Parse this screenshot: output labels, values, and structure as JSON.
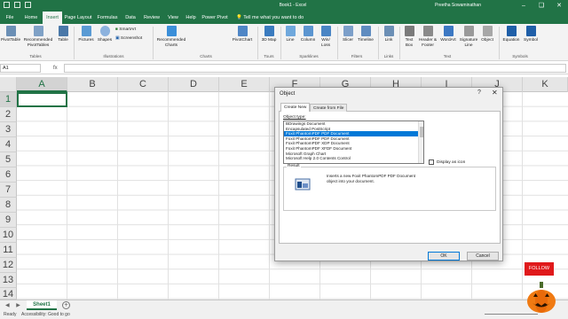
{
  "titlebar": {
    "title": "Book1 - Excel",
    "user": "Preetha Sowaminathan"
  },
  "tabs": [
    "File",
    "Home",
    "Insert",
    "Page Layout",
    "Formulas",
    "Data",
    "Review",
    "View",
    "Help",
    "Power Pivot"
  ],
  "active_tab": "Insert",
  "tell_me": "Tell me what you want to do",
  "ribbon": {
    "buttons": [
      "PivotTable",
      "Recommended PivotTables",
      "Table",
      "Pictures",
      "Shapes",
      "SmartArt",
      "Screenshot",
      "Recommended Charts",
      "PivotChart",
      "3D Map",
      "Line",
      "Column",
      "Win/ Loss",
      "Slicer",
      "Timeline",
      "Link",
      "Text Box",
      "Header & Footer",
      "WordArt",
      "Signature Line",
      "Object",
      "Equation",
      "Symbol"
    ],
    "groups": [
      "Tables",
      "Illustrations",
      "Charts",
      "Tours",
      "Sparklines",
      "Filters",
      "Links",
      "Text",
      "Symbols"
    ]
  },
  "formula_bar": {
    "name_box": "A1",
    "fx": "fx",
    "value": ""
  },
  "columns": [
    "A",
    "B",
    "C",
    "D",
    "E",
    "F",
    "G",
    "H",
    "I",
    "J",
    "K"
  ],
  "rows": [
    "1",
    "2",
    "3",
    "4",
    "5",
    "6",
    "7",
    "8",
    "9",
    "10",
    "11",
    "12",
    "13",
    "14"
  ],
  "sheet": {
    "tab": "Sheet1",
    "add": "+",
    "nav": "◀ ▶"
  },
  "status": {
    "ready": "Ready",
    "accessibility": "Accessibility: Good to go"
  },
  "dialog": {
    "title": "Object",
    "help": "?",
    "close": "✕",
    "tabs": [
      "Create New",
      "Create from File"
    ],
    "object_type_label": "Object type:",
    "object_types": [
      "BDrawings Document",
      "Encapsulated PostScript",
      "Foxit PhantomPDF PDF Document",
      "Foxit PhantomPDF PDF Document",
      "Foxit PhantomPDF XDP Document",
      "Foxit PhantomPDF XFDF Document",
      "Microsoft Graph Chart",
      "Microsoft Help 2.0 Contents Control"
    ],
    "selected_index": 2,
    "display_as_icon": "Display as icon",
    "result_label": "Result",
    "result_text": "Inserts a new Foxit PhantomPDF PDF Document object into your document.",
    "ok": "OK",
    "cancel": "Cancel"
  },
  "follow_button": "FOLLOW",
  "colors": {
    "excel_green": "#217346",
    "selection_blue": "#0078d7",
    "follow_red": "#e0191b",
    "pumpkin": "#f07a12"
  }
}
